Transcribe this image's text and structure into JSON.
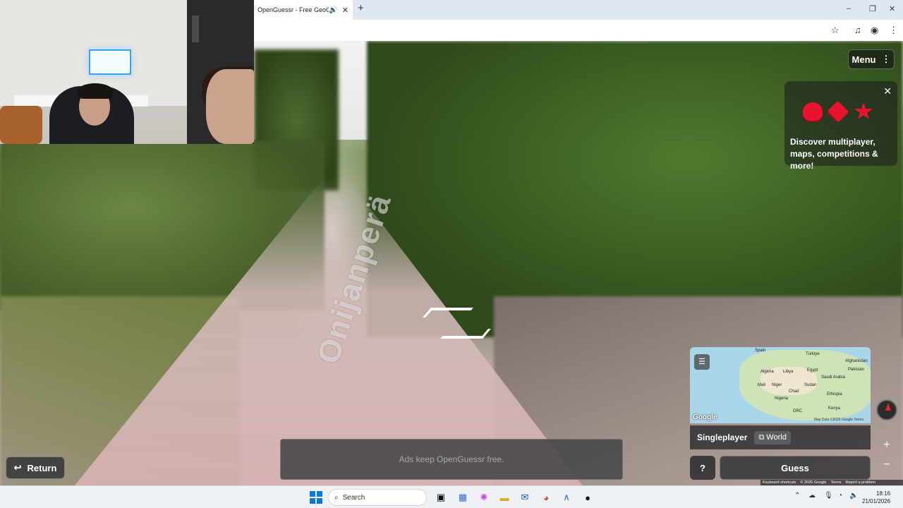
{
  "browser": {
    "tab_title": "OpenGuessr - Free GeoGue",
    "audio_icon": "speaker-icon",
    "close_label": "✕",
    "new_tab_label": "+"
  },
  "window_controls": {
    "minimize": "–",
    "maximize": "❐",
    "close": "✕"
  },
  "street": {
    "road_name": "Onijanperä"
  },
  "top_right": {
    "menu_label": "Menu",
    "promo_text": "Discover multiplayer, maps, competitions & more!",
    "promo_close": "✕"
  },
  "map": {
    "labels": [
      "Spain",
      "Türkiye",
      "Algeria",
      "Libya",
      "Egypt",
      "Afghanistan",
      "Pakistan",
      "Saudi Arabia",
      "Mali",
      "Niger",
      "Sudan",
      "Chad",
      "Ethiopia",
      "Nigeria",
      "DRC",
      "Kenya"
    ],
    "google": "Google",
    "attribution": "Map Data ©2026 Google    Terms",
    "mode": "Singleplayer",
    "world": "World"
  },
  "actions": {
    "help": "?",
    "guess": "Guess",
    "return": "Return",
    "zoom_in": "+",
    "zoom_out": "−"
  },
  "ad_text": "Ads keep OpenGuessr free.",
  "footer_links": [
    "Keyboard shortcuts",
    "© 2026 Google",
    "Terms",
    "Report a problem"
  ],
  "taskbar": {
    "search_placeholder": "Search",
    "time": "18:16",
    "date": "21/01/2026"
  }
}
